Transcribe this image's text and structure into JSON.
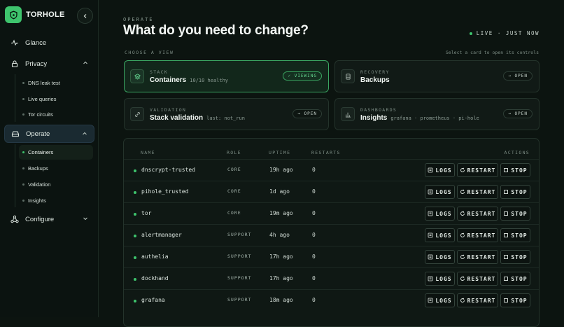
{
  "brand": {
    "name": "TORHOLE",
    "name_a": "TOR",
    "name_b": "HOLE"
  },
  "nav": {
    "glance": "Glance",
    "privacy": "Privacy",
    "privacy_items": [
      "DNS leak test",
      "Live queries",
      "Tor circuits"
    ],
    "operate": "Operate",
    "operate_items": [
      "Containers",
      "Backups",
      "Validation",
      "Insights"
    ],
    "configure": "Configure"
  },
  "header": {
    "eyebrow": "OPERATE",
    "title": "What do you need to change?",
    "live": "LIVE · JUST NOW"
  },
  "views": {
    "label": "CHOOSE A VIEW",
    "hint": "Select a card to open its controls",
    "cards": [
      {
        "kicker": "STACK",
        "name": "Containers",
        "meta": "10/10 healthy",
        "action": "✓ VIEWING",
        "active": true
      },
      {
        "kicker": "RECOVERY",
        "name": "Backups",
        "meta": "",
        "action": "→ OPEN",
        "active": false
      },
      {
        "kicker": "VALIDATION",
        "name": "Stack validation",
        "meta": "last: not_run",
        "action": "→ OPEN",
        "active": false
      },
      {
        "kicker": "DASHBOARDS",
        "name": "Insights",
        "meta": "grafana · prometheus · pi-hole",
        "action": "→ OPEN",
        "active": false
      }
    ]
  },
  "table": {
    "headers": {
      "name": "NAME",
      "role": "ROLE",
      "uptime": "UPTIME",
      "restarts": "RESTARTS",
      "actions": "ACTIONS"
    },
    "actions": {
      "logs": "LOGS",
      "restart": "RESTART",
      "stop": "STOP"
    },
    "rows": [
      {
        "name": "dnscrypt-trusted",
        "role": "CORE",
        "uptime": "19h ago",
        "restarts": "0"
      },
      {
        "name": "pihole_trusted",
        "role": "CORE",
        "uptime": "1d ago",
        "restarts": "0"
      },
      {
        "name": "tor",
        "role": "CORE",
        "uptime": "19m ago",
        "restarts": "0"
      },
      {
        "name": "alertmanager",
        "role": "SUPPORT",
        "uptime": "4h ago",
        "restarts": "0"
      },
      {
        "name": "authelia",
        "role": "SUPPORT",
        "uptime": "17h ago",
        "restarts": "0"
      },
      {
        "name": "dockhand",
        "role": "SUPPORT",
        "uptime": "17h ago",
        "restarts": "0"
      },
      {
        "name": "grafana",
        "role": "SUPPORT",
        "uptime": "18m ago",
        "restarts": "0"
      }
    ]
  },
  "colors": {
    "accent": "#3ec46d",
    "bg": "#0c1410",
    "active_nav": "#1a2a31"
  }
}
